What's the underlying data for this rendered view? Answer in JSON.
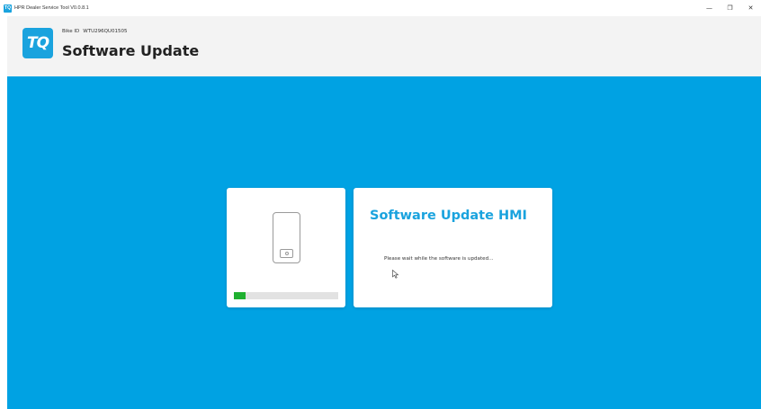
{
  "window": {
    "title": "HPR Dealer Service Tool V0.0.8.1",
    "app_icon_text": "TQ",
    "controls": {
      "minimize": "—",
      "maximize": "❐",
      "close": "✕"
    }
  },
  "header": {
    "logo_text": "TQ",
    "bike_id_label": "Bike ID",
    "bike_id_value": "WTU296QU01505",
    "title": "Software Update"
  },
  "update": {
    "card_title": "Software Update HMI",
    "message": "Please wait while the software is updated...",
    "progress": 0.11
  },
  "colors": {
    "accent": "#1aa3de",
    "background": "#00a2e3",
    "progress": "#1fb030"
  },
  "icons": [
    "phone-icon",
    "mouse-cursor-icon"
  ]
}
